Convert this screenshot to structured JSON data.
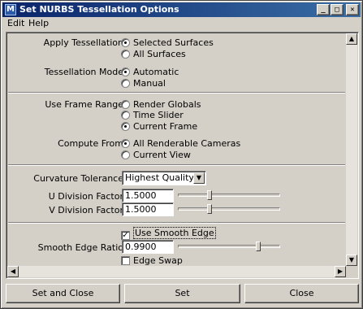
{
  "window": {
    "title": "Set NURBS Tessellation Options",
    "app_icon_glyph": "M",
    "minimize_glyph": "_",
    "maximize_glyph": "□",
    "close_glyph": "✕"
  },
  "menu": [
    "Edit",
    "Help"
  ],
  "apply_tessellation": {
    "label": "Apply Tessellation",
    "options": [
      "Selected Surfaces",
      "All Surfaces"
    ],
    "selected": "Selected Surfaces"
  },
  "tessellation_mode": {
    "label": "Tessellation Mode",
    "options": [
      "Automatic",
      "Manual"
    ],
    "selected": "Automatic"
  },
  "use_frame_range": {
    "label": "Use Frame Range",
    "options": [
      "Render Globals",
      "Time Slider",
      "Current Frame"
    ],
    "selected": "Current Frame"
  },
  "compute_from": {
    "label": "Compute From",
    "options": [
      "All Renderable Cameras",
      "Current View"
    ],
    "selected": "All Renderable Cameras"
  },
  "curvature_tolerance": {
    "label": "Curvature Tolerance",
    "value": "Highest Quality"
  },
  "u_division_factor": {
    "label": "U Division Factor",
    "value": "1.5000",
    "slider_level": 0.3
  },
  "v_division_factor": {
    "label": "V Division Factor",
    "value": "1.5000",
    "slider_level": 0.3
  },
  "use_smooth_edge": {
    "label": "Use Smooth Edge",
    "checked": true
  },
  "smooth_edge_ratio": {
    "label": "Smooth Edge Ratio",
    "value": "0.9900",
    "slider_level": 0.8
  },
  "edge_swap": {
    "label": "Edge Swap",
    "checked": false
  },
  "buttons": {
    "set_and_close": "Set and Close",
    "set": "Set",
    "close": "Close"
  },
  "icons": {
    "radio_selected": "radio-on-icon",
    "radio_unselected": "radio-off-icon",
    "check": "checkmark-icon"
  }
}
